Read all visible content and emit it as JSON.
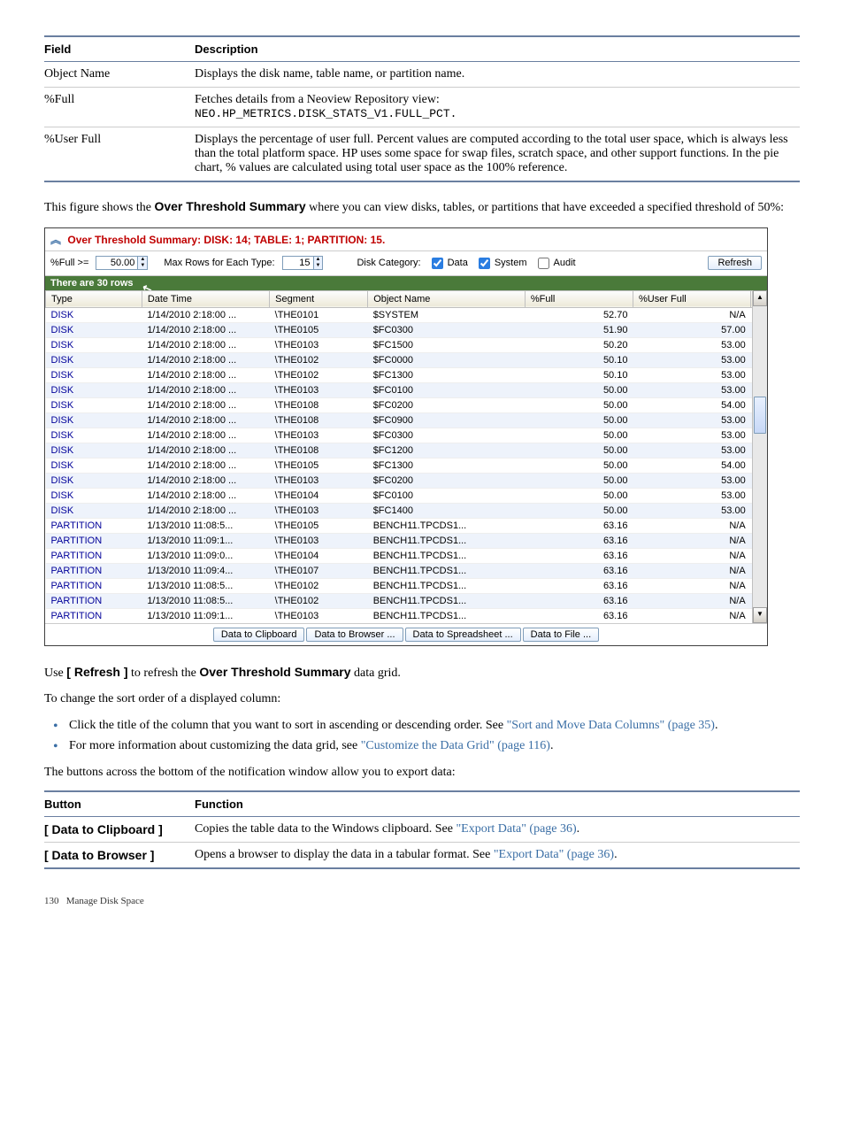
{
  "field_table": {
    "headers": [
      "Field",
      "Description"
    ],
    "rows": [
      {
        "field": "Object Name",
        "desc": "Displays the disk name, table name, or partition name."
      },
      {
        "field": "%Full",
        "desc_line1": "Fetches details from a Neoview Repository view:",
        "code": "NEO.HP_METRICS.DISK_STATS_V1.FULL_PCT."
      },
      {
        "field": "%User Full",
        "desc": "Displays the percentage of user full. Percent values are computed according to the total user space, which is always less than the total platform space. HP uses some space for swap files, scratch space, and other support functions. In the pie chart, % values are calculated using total user space as the 100% reference."
      }
    ]
  },
  "intro": {
    "prefix": "This figure shows the ",
    "bold": "Over Threshold Summary",
    "suffix": " where you can view disks, tables, or partitions that have exceeded a specified threshold of 50%:"
  },
  "shot": {
    "title": "Over Threshold Summary: DISK: 14; TABLE: 1; PARTITION: 15.",
    "controls": {
      "pct_label": "%Full >=",
      "pct_value": "50.00",
      "maxrows_label": "Max Rows for Each Type:",
      "maxrows_value": "15",
      "cat_label": "Disk Category:",
      "opts": [
        "Data",
        "System",
        "Audit"
      ],
      "opts_state": [
        true,
        true,
        false
      ],
      "refresh": "Refresh"
    },
    "status": "There are 30 rows",
    "headers": [
      "Type",
      "Date Time",
      "Segment",
      "Object Name",
      "%Full",
      "%User Full"
    ],
    "rows": [
      [
        "DISK",
        "1/14/2010 2:18:00 ...",
        "\\THE0101",
        "$SYSTEM",
        "52.70",
        "N/A"
      ],
      [
        "DISK",
        "1/14/2010 2:18:00 ...",
        "\\THE0105",
        "$FC0300",
        "51.90",
        "57.00"
      ],
      [
        "DISK",
        "1/14/2010 2:18:00 ...",
        "\\THE0103",
        "$FC1500",
        "50.20",
        "53.00"
      ],
      [
        "DISK",
        "1/14/2010 2:18:00 ...",
        "\\THE0102",
        "$FC0000",
        "50.10",
        "53.00"
      ],
      [
        "DISK",
        "1/14/2010 2:18:00 ...",
        "\\THE0102",
        "$FC1300",
        "50.10",
        "53.00"
      ],
      [
        "DISK",
        "1/14/2010 2:18:00 ...",
        "\\THE0103",
        "$FC0100",
        "50.00",
        "53.00"
      ],
      [
        "DISK",
        "1/14/2010 2:18:00 ...",
        "\\THE0108",
        "$FC0200",
        "50.00",
        "54.00"
      ],
      [
        "DISK",
        "1/14/2010 2:18:00 ...",
        "\\THE0108",
        "$FC0900",
        "50.00",
        "53.00"
      ],
      [
        "DISK",
        "1/14/2010 2:18:00 ...",
        "\\THE0103",
        "$FC0300",
        "50.00",
        "53.00"
      ],
      [
        "DISK",
        "1/14/2010 2:18:00 ...",
        "\\THE0108",
        "$FC1200",
        "50.00",
        "53.00"
      ],
      [
        "DISK",
        "1/14/2010 2:18:00 ...",
        "\\THE0105",
        "$FC1300",
        "50.00",
        "54.00"
      ],
      [
        "DISK",
        "1/14/2010 2:18:00 ...",
        "\\THE0103",
        "$FC0200",
        "50.00",
        "53.00"
      ],
      [
        "DISK",
        "1/14/2010 2:18:00 ...",
        "\\THE0104",
        "$FC0100",
        "50.00",
        "53.00"
      ],
      [
        "DISK",
        "1/14/2010 2:18:00 ...",
        "\\THE0103",
        "$FC1400",
        "50.00",
        "53.00"
      ],
      [
        "PARTITION",
        "1/13/2010 11:08:5...",
        "\\THE0105",
        "BENCH11.TPCDS1...",
        "63.16",
        "N/A"
      ],
      [
        "PARTITION",
        "1/13/2010 11:09:1...",
        "\\THE0103",
        "BENCH11.TPCDS1...",
        "63.16",
        "N/A"
      ],
      [
        "PARTITION",
        "1/13/2010 11:09:0...",
        "\\THE0104",
        "BENCH11.TPCDS1...",
        "63.16",
        "N/A"
      ],
      [
        "PARTITION",
        "1/13/2010 11:09:4...",
        "\\THE0107",
        "BENCH11.TPCDS1...",
        "63.16",
        "N/A"
      ],
      [
        "PARTITION",
        "1/13/2010 11:08:5...",
        "\\THE0102",
        "BENCH11.TPCDS1...",
        "63.16",
        "N/A"
      ],
      [
        "PARTITION",
        "1/13/2010 11:08:5...",
        "\\THE0102",
        "BENCH11.TPCDS1...",
        "63.16",
        "N/A"
      ],
      [
        "PARTITION",
        "1/13/2010 11:09:1...",
        "\\THE0103",
        "BENCH11.TPCDS1...",
        "63.16",
        "N/A"
      ]
    ],
    "buttons": [
      "Data to Clipboard",
      "Data to Browser ...",
      "Data to Spreadsheet ...",
      "Data to File ..."
    ]
  },
  "refresh_line": {
    "prefix": "Use ",
    "btn": "[ Refresh ]",
    "mid": " to refresh the ",
    "title": "Over Threshold Summary",
    "suffix": " data grid."
  },
  "sort_intro": "To change the sort order of a displayed column:",
  "bullets": [
    {
      "text": "Click the title of the column that you want to sort in ascending or descending order. See ",
      "link": "\"Sort and Move Data Columns\" (page 35)",
      "tail": "."
    },
    {
      "text": "For more information about customizing the data grid, see ",
      "link": "\"Customize the Data Grid\" (page 116)",
      "tail": "."
    }
  ],
  "export_line": "The buttons across the bottom of the notification window allow you to export data:",
  "button_table": {
    "headers": [
      "Button",
      "Function"
    ],
    "rows": [
      {
        "btn": "[ Data to Clipboard ]",
        "pre": "Copies the table data to the Windows clipboard. See ",
        "link": "\"Export Data\" (page 36)",
        "post": "."
      },
      {
        "btn": "[ Data to Browser ]",
        "pre": "Opens a browser to display the data in a tabular format. See ",
        "link": "\"Export Data\" (page 36)",
        "post": "."
      }
    ]
  },
  "footer": {
    "page": "130",
    "title": "Manage Disk Space"
  }
}
